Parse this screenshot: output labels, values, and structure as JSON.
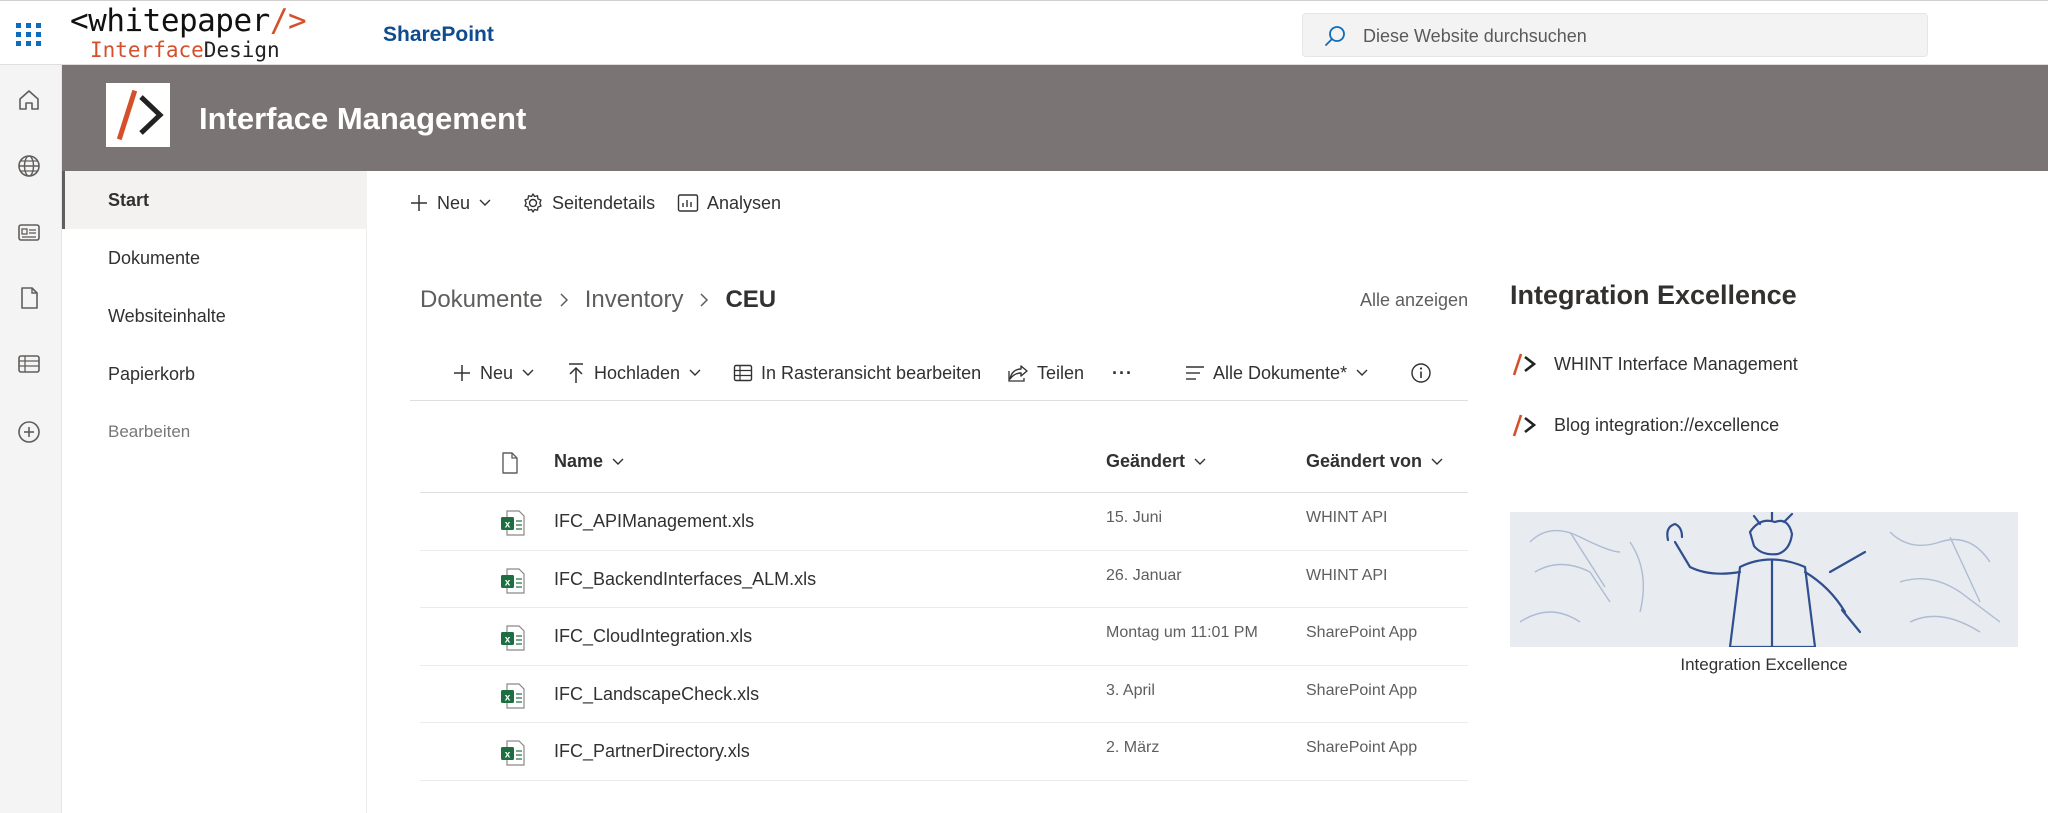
{
  "suitebar": {
    "logo_line1_a": "<whitepaper",
    "logo_line1_b": "/>",
    "logo_line2_a": "Interface",
    "logo_line2_b": "Design",
    "app_name": "SharePoint",
    "search_placeholder": "Diese Website durchsuchen"
  },
  "site": {
    "title": "Interface Management"
  },
  "leftnav": {
    "items": [
      {
        "label": "Start"
      },
      {
        "label": "Dokumente"
      },
      {
        "label": "Websiteinhalte"
      },
      {
        "label": "Papierkorb"
      }
    ],
    "edit_label": "Bearbeiten"
  },
  "commandbar": {
    "new_label": "Neu",
    "page_details_label": "Seitendetails",
    "analytics_label": "Analysen"
  },
  "breadcrumb": {
    "items": [
      "Dokumente",
      "Inventory",
      "CEU"
    ],
    "show_all": "Alle anzeigen"
  },
  "library_toolbar": {
    "new_label": "Neu",
    "upload_label": "Hochladen",
    "grid_edit_label": "In Rasteransicht bearbeiten",
    "share_label": "Teilen",
    "more_label": "···",
    "view_label": "Alle Dokumente*"
  },
  "table": {
    "columns": {
      "name": "Name",
      "modified": "Geändert",
      "modified_by": "Geändert von"
    },
    "rows": [
      {
        "name": "IFC_APIManagement.xls",
        "modified": "15. Juni",
        "modified_by": "WHINT API"
      },
      {
        "name": "IFC_BackendInterfaces_ALM.xls",
        "modified": "26. Januar",
        "modified_by": "WHINT API"
      },
      {
        "name": "IFC_CloudIntegration.xls",
        "modified": "Montag um 11:01 PM",
        "modified_by": "SharePoint App"
      },
      {
        "name": "IFC_LandscapeCheck.xls",
        "modified": "3. April",
        "modified_by": "SharePoint App"
      },
      {
        "name": "IFC_PartnerDirectory.xls",
        "modified": "2. März",
        "modified_by": "SharePoint App"
      }
    ]
  },
  "quicklinks": {
    "title": "Integration Excellence",
    "links": [
      {
        "label": "WHINT Interface Management"
      },
      {
        "label": "Blog integration://excellence"
      }
    ]
  },
  "image_part": {
    "caption": "Integration Excellence"
  },
  "colors": {
    "header_band": "#7a7574",
    "brand_blue": "#0f6cbd",
    "accent_orange": "#d4502c",
    "excel_green": "#1d6f42"
  }
}
